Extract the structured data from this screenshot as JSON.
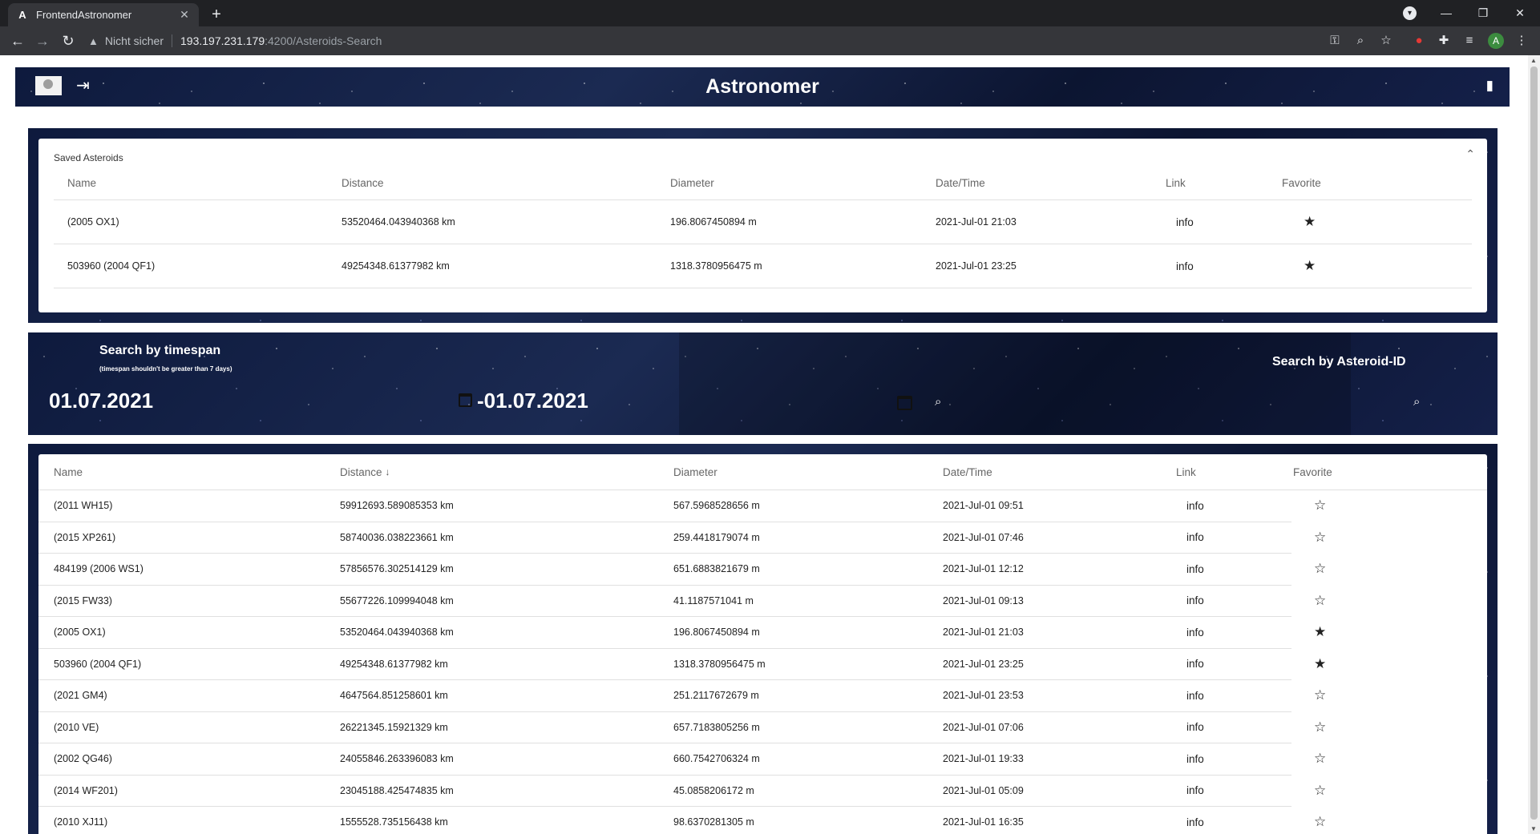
{
  "browser": {
    "tab_title": "FrontendAstronomer",
    "tab_favicon": "A",
    "close_glyph": "✕",
    "newtab_glyph": "+",
    "insecure_label": "Nicht sicher",
    "url_host": "193.197.231.179",
    "url_path": ":4200/Asteroids-Search",
    "profile_initial": "A"
  },
  "header": {
    "title": "Astronomer"
  },
  "saved": {
    "title": "Saved Asteroids",
    "columns": [
      "Name",
      "Distance",
      "Diameter",
      "Date/Time",
      "Link",
      "Favorite"
    ],
    "rows": [
      {
        "name": "(2005 OX1)",
        "distance": "53520464.043940368 km",
        "diameter": "196.8067450894 m",
        "datetime": "2021-Jul-01 21:03",
        "link": "info",
        "favorite": true
      },
      {
        "name": "503960 (2004 QF1)",
        "distance": "49254348.61377982 km",
        "diameter": "1318.3780956475 m",
        "datetime": "2021-Jul-01 23:25",
        "link": "info",
        "favorite": true
      }
    ]
  },
  "search": {
    "timespan_title": "Search by timespan",
    "timespan_note": "(timespan shouldn't be greater than 7 days)",
    "from_date": "01.07.2021",
    "to_date": "-01.07.2021",
    "id_title": "Search by Asteroid-ID"
  },
  "results": {
    "columns": [
      "Name",
      "Distance",
      "Diameter",
      "Date/Time",
      "Link",
      "Favorite"
    ],
    "sort_column": "Distance",
    "sort_glyph": "↓",
    "rows": [
      {
        "name": "(2011 WH15)",
        "distance": "59912693.589085353 km",
        "diameter": "567.5968528656 m",
        "datetime": "2021-Jul-01 09:51",
        "link": "info",
        "favorite": false
      },
      {
        "name": "(2015 XP261)",
        "distance": "58740036.038223661 km",
        "diameter": "259.4418179074 m",
        "datetime": "2021-Jul-01 07:46",
        "link": "info",
        "favorite": false
      },
      {
        "name": "484199 (2006 WS1)",
        "distance": "57856576.302514129 km",
        "diameter": "651.6883821679 m",
        "datetime": "2021-Jul-01 12:12",
        "link": "info",
        "favorite": false
      },
      {
        "name": "(2015 FW33)",
        "distance": "55677226.109994048 km",
        "diameter": "41.1187571041 m",
        "datetime": "2021-Jul-01 09:13",
        "link": "info",
        "favorite": false
      },
      {
        "name": "(2005 OX1)",
        "distance": "53520464.043940368 km",
        "diameter": "196.8067450894 m",
        "datetime": "2021-Jul-01 21:03",
        "link": "info",
        "favorite": true
      },
      {
        "name": "503960 (2004 QF1)",
        "distance": "49254348.61377982 km",
        "diameter": "1318.3780956475 m",
        "datetime": "2021-Jul-01 23:25",
        "link": "info",
        "favorite": true
      },
      {
        "name": "(2021 GM4)",
        "distance": "4647564.851258601 km",
        "diameter": "251.2117672679 m",
        "datetime": "2021-Jul-01 23:53",
        "link": "info",
        "favorite": false
      },
      {
        "name": "(2010 VE)",
        "distance": "26221345.15921329 km",
        "diameter": "657.7183805256 m",
        "datetime": "2021-Jul-01 07:06",
        "link": "info",
        "favorite": false
      },
      {
        "name": "(2002 QG46)",
        "distance": "24055846.263396083 km",
        "diameter": "660.7542706324 m",
        "datetime": "2021-Jul-01 19:33",
        "link": "info",
        "favorite": false
      },
      {
        "name": "(2014 WF201)",
        "distance": "23045188.425474835 km",
        "diameter": "45.0858206172 m",
        "datetime": "2021-Jul-01 05:09",
        "link": "info",
        "favorite": false
      },
      {
        "name": "(2010 XJ11)",
        "distance": "1555528.735156438 km",
        "diameter": "98.6370281305 m",
        "datetime": "2021-Jul-01 16:35",
        "link": "info",
        "favorite": false
      }
    ]
  },
  "icons": {
    "star_filled": "★",
    "star_empty": "☆"
  }
}
